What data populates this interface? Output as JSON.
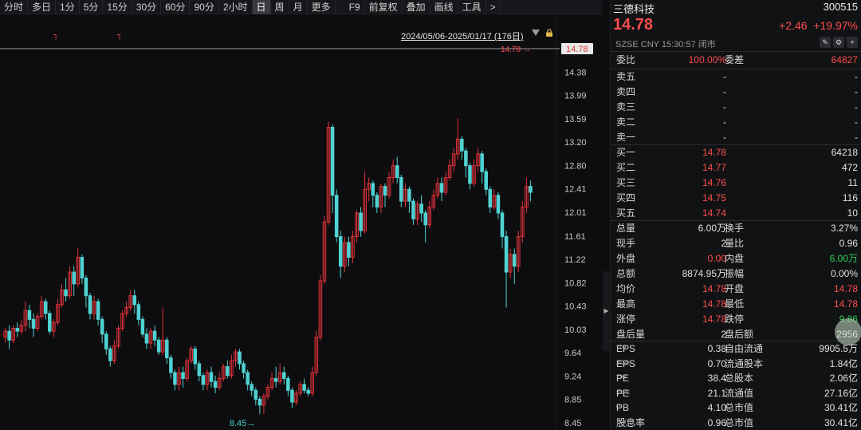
{
  "toolbar": {
    "periods": [
      "分时",
      "多日",
      "1分",
      "5分",
      "15分",
      "30分",
      "60分",
      "90分",
      "2小时",
      "日",
      "周",
      "月",
      "更多"
    ],
    "active_period": "日",
    "tools": [
      "F9",
      "前复权",
      "叠加",
      "画线",
      "工具",
      ">"
    ]
  },
  "chart": {
    "range_label": "2024/05/06-2025/01/17 (176日)",
    "price_levels": [
      "14.78",
      "14.38",
      "13.99",
      "13.59",
      "13.20",
      "12.80",
      "12.41",
      "12.01",
      "11.61",
      "11.22",
      "10.82",
      "10.43",
      "10.03",
      "9.64",
      "9.24",
      "8.85",
      "8.45"
    ],
    "current_price_tag": "14.78",
    "current_price_line_label": "14.78",
    "low_marker": "8.45",
    "ymin": 8.45,
    "ymax": 14.78,
    "up_color": "#e0333a",
    "down_color": "#4fd2d2",
    "candles": [
      [
        9.9,
        10.0,
        10.05,
        9.8
      ],
      [
        10.0,
        9.85,
        10.1,
        9.7
      ],
      [
        9.85,
        10.05,
        10.1,
        9.8
      ],
      [
        10.05,
        10.0,
        10.15,
        9.9
      ],
      [
        10.0,
        10.1,
        10.2,
        9.95
      ],
      [
        10.1,
        10.35,
        10.5,
        10.0
      ],
      [
        10.35,
        10.2,
        10.45,
        10.05
      ],
      [
        10.2,
        10.05,
        10.3,
        9.9
      ],
      [
        10.05,
        10.25,
        10.3,
        10.0
      ],
      [
        10.25,
        10.5,
        10.6,
        10.2
      ],
      [
        10.5,
        10.3,
        10.55,
        10.2
      ],
      [
        10.3,
        10.0,
        10.35,
        9.95
      ],
      [
        10.0,
        10.15,
        10.2,
        9.9
      ],
      [
        10.15,
        10.45,
        10.55,
        10.1
      ],
      [
        10.45,
        10.7,
        10.8,
        10.4
      ],
      [
        10.7,
        10.6,
        10.9,
        10.5
      ],
      [
        10.6,
        11.0,
        11.1,
        10.55
      ],
      [
        11.0,
        10.8,
        11.1,
        10.6
      ],
      [
        10.8,
        11.25,
        11.4,
        10.75
      ],
      [
        11.25,
        10.9,
        11.3,
        10.8
      ],
      [
        10.9,
        10.6,
        10.95,
        10.4
      ],
      [
        10.6,
        10.3,
        10.65,
        10.2
      ],
      [
        10.3,
        10.5,
        10.6,
        10.2
      ],
      [
        10.5,
        10.2,
        10.55,
        10.1
      ],
      [
        10.2,
        9.95,
        10.25,
        9.8
      ],
      [
        9.95,
        9.7,
        10.0,
        9.6
      ],
      [
        9.7,
        9.5,
        9.75,
        9.4
      ],
      [
        9.5,
        9.75,
        9.85,
        9.45
      ],
      [
        9.75,
        10.05,
        10.1,
        9.7
      ],
      [
        10.05,
        10.3,
        10.35,
        10.0
      ],
      [
        10.3,
        10.4,
        10.5,
        10.25
      ],
      [
        10.4,
        10.6,
        10.7,
        10.35
      ],
      [
        10.6,
        10.45,
        10.7,
        10.3
      ],
      [
        10.45,
        10.2,
        10.5,
        10.1
      ],
      [
        10.2,
        9.95,
        10.25,
        9.9
      ],
      [
        9.95,
        9.8,
        10.05,
        9.7
      ],
      [
        9.8,
        10.0,
        10.05,
        9.7
      ],
      [
        10.0,
        9.85,
        10.1,
        9.75
      ],
      [
        9.85,
        9.65,
        9.9,
        9.6
      ],
      [
        9.65,
        9.85,
        10.4,
        9.6
      ],
      [
        9.85,
        9.55,
        9.9,
        9.45
      ],
      [
        9.55,
        9.3,
        9.6,
        9.2
      ],
      [
        9.3,
        9.1,
        9.35,
        9.0
      ],
      [
        9.1,
        9.3,
        9.4,
        9.0
      ],
      [
        9.3,
        9.2,
        9.4,
        9.05
      ],
      [
        9.2,
        9.5,
        9.55,
        9.15
      ],
      [
        9.5,
        9.7,
        9.75,
        9.45
      ],
      [
        9.7,
        9.45,
        9.75,
        9.35
      ],
      [
        9.45,
        9.25,
        9.5,
        9.15
      ],
      [
        9.25,
        9.1,
        9.3,
        9.0
      ],
      [
        9.1,
        9.3,
        9.35,
        9.0
      ],
      [
        9.3,
        9.15,
        9.4,
        9.05
      ],
      [
        9.15,
        9.05,
        9.25,
        8.95
      ],
      [
        9.05,
        9.2,
        9.3,
        9.0
      ],
      [
        9.2,
        9.4,
        9.45,
        9.15
      ],
      [
        9.4,
        9.25,
        9.5,
        9.2
      ],
      [
        9.25,
        9.5,
        9.6,
        9.2
      ],
      [
        9.5,
        9.65,
        9.7,
        9.4
      ],
      [
        9.65,
        9.45,
        9.7,
        9.35
      ],
      [
        9.45,
        9.3,
        9.5,
        9.2
      ],
      [
        9.3,
        9.1,
        9.35,
        9.0
      ],
      [
        9.1,
        9.0,
        9.15,
        8.9
      ],
      [
        9.0,
        8.85,
        9.05,
        8.75
      ],
      [
        8.85,
        8.75,
        8.9,
        8.6
      ],
      [
        8.75,
        8.9,
        8.95,
        8.6
      ],
      [
        8.9,
        9.05,
        9.1,
        8.85
      ],
      [
        9.05,
        9.2,
        9.3,
        9.0
      ],
      [
        9.2,
        9.15,
        9.4,
        9.05
      ],
      [
        9.15,
        9.3,
        9.45,
        9.1
      ],
      [
        9.3,
        9.2,
        9.4,
        9.1
      ],
      [
        9.2,
        9.0,
        9.25,
        8.9
      ],
      [
        9.0,
        8.8,
        9.05,
        8.7
      ],
      [
        8.8,
        8.95,
        9.0,
        8.75
      ],
      [
        8.95,
        9.1,
        9.15,
        8.9
      ],
      [
        9.1,
        9.0,
        9.2,
        8.95
      ],
      [
        9.0,
        8.95,
        9.05,
        8.9
      ],
      [
        8.95,
        9.3,
        9.4,
        8.9
      ],
      [
        9.3,
        9.9,
        10.0,
        9.25
      ],
      [
        9.9,
        10.85,
        10.95,
        9.85
      ],
      [
        10.85,
        11.85,
        11.95,
        10.8
      ],
      [
        11.85,
        13.45,
        13.55,
        11.8
      ],
      [
        13.45,
        12.3,
        13.5,
        12.0
      ],
      [
        12.3,
        11.6,
        12.4,
        11.5
      ],
      [
        11.6,
        11.1,
        11.7,
        10.9
      ],
      [
        11.1,
        11.5,
        11.6,
        11.0
      ],
      [
        11.5,
        11.25,
        11.6,
        11.1
      ],
      [
        11.25,
        11.6,
        11.7,
        11.15
      ],
      [
        11.6,
        12.0,
        12.05,
        11.5
      ],
      [
        12.0,
        11.7,
        12.1,
        11.6
      ],
      [
        11.7,
        12.4,
        12.7,
        11.65
      ],
      [
        12.4,
        12.5,
        12.6,
        12.2
      ],
      [
        12.5,
        12.3,
        12.55,
        12.1
      ],
      [
        12.3,
        12.1,
        12.35,
        12.0
      ],
      [
        12.1,
        12.45,
        12.5,
        12.0
      ],
      [
        12.45,
        12.3,
        12.5,
        12.1
      ],
      [
        12.3,
        12.6,
        12.7,
        12.25
      ],
      [
        12.6,
        12.8,
        12.9,
        12.5
      ],
      [
        12.8,
        12.6,
        12.95,
        12.5
      ],
      [
        12.6,
        12.2,
        12.65,
        12.1
      ],
      [
        12.2,
        12.4,
        12.5,
        12.1
      ],
      [
        12.4,
        12.2,
        12.45,
        12.0
      ],
      [
        12.2,
        11.9,
        12.25,
        11.8
      ],
      [
        11.9,
        12.15,
        12.2,
        11.8
      ],
      [
        12.15,
        12.0,
        12.3,
        11.85
      ],
      [
        12.0,
        11.8,
        12.05,
        11.5
      ],
      [
        11.8,
        12.1,
        12.2,
        11.75
      ],
      [
        12.1,
        12.3,
        12.4,
        12.05
      ],
      [
        12.3,
        12.5,
        12.6,
        12.25
      ],
      [
        12.5,
        12.35,
        12.6,
        12.2
      ],
      [
        12.35,
        12.6,
        12.7,
        12.3
      ],
      [
        12.6,
        12.8,
        12.9,
        12.55
      ],
      [
        12.8,
        13.0,
        13.1,
        12.7
      ],
      [
        13.0,
        13.25,
        13.6,
        12.9
      ],
      [
        13.25,
        13.05,
        13.3,
        12.9
      ],
      [
        13.05,
        12.8,
        13.1,
        12.6
      ],
      [
        12.8,
        12.5,
        12.85,
        12.4
      ],
      [
        12.5,
        12.8,
        12.9,
        12.45
      ],
      [
        12.8,
        13.0,
        13.1,
        12.7
      ],
      [
        13.0,
        12.7,
        13.05,
        12.5
      ],
      [
        12.7,
        12.4,
        12.75,
        12.3
      ],
      [
        12.4,
        12.1,
        12.45,
        12.0
      ],
      [
        12.1,
        12.3,
        12.4,
        12.05
      ],
      [
        12.3,
        12.0,
        12.35,
        11.9
      ],
      [
        12.0,
        11.6,
        12.05,
        11.4
      ],
      [
        11.6,
        11.0,
        11.7,
        10.4
      ],
      [
        11.0,
        11.3,
        11.4,
        10.9
      ],
      [
        11.3,
        11.1,
        11.4,
        10.8
      ],
      [
        11.1,
        11.6,
        11.7,
        11.0
      ],
      [
        11.6,
        12.1,
        12.2,
        11.5
      ],
      [
        12.1,
        12.45,
        12.6,
        12.0
      ],
      [
        12.45,
        12.35,
        12.55,
        12.2
      ]
    ],
    "prelim_marks": [
      "┐",
      "┐"
    ]
  },
  "panel": {
    "name": "三德科技",
    "code": "300515",
    "price": "14.78",
    "change": "+2.46",
    "change_pct": "+19.97%",
    "meta": "SZSE  CNY  15:30:57  闭市",
    "header_icons": [
      "edit-icon",
      "settings-icon",
      "add-icon"
    ],
    "wb": {
      "label": "委比",
      "value": "100.00%",
      "label2": "委差",
      "value2": "64827"
    },
    "asks": [
      {
        "label": "卖五",
        "price": "-",
        "vol": "-"
      },
      {
        "label": "卖四",
        "price": "-",
        "vol": "-"
      },
      {
        "label": "卖三",
        "price": "-",
        "vol": "-"
      },
      {
        "label": "卖二",
        "price": "-",
        "vol": "-"
      },
      {
        "label": "卖一",
        "price": "-",
        "vol": "-"
      }
    ],
    "bids": [
      {
        "label": "买一",
        "price": "14.78",
        "vol": "64218"
      },
      {
        "label": "买二",
        "price": "14.77",
        "vol": "472"
      },
      {
        "label": "买三",
        "price": "14.76",
        "vol": "11"
      },
      {
        "label": "买四",
        "price": "14.75",
        "vol": "116"
      },
      {
        "label": "买五",
        "price": "14.74",
        "vol": "10"
      }
    ],
    "stats": [
      {
        "l1": "总量",
        "v1": "6.00万",
        "c1": "white",
        "l2": "换手",
        "v2": "3.27%",
        "c2": "white"
      },
      {
        "l1": "现手",
        "v1": "2",
        "c1": "white",
        "l2": "量比",
        "v2": "0.96",
        "c2": "white"
      },
      {
        "l1": "外盘",
        "v1": "0.00",
        "c1": "red",
        "l2": "内盘",
        "v2": "6.00万",
        "c2": "green"
      },
      {
        "l1": "总额",
        "v1": "8874.95万",
        "c1": "white",
        "l2": "振幅",
        "v2": "0.00%",
        "c2": "white"
      },
      {
        "l1": "均价",
        "v1": "14.78",
        "c1": "red",
        "l2": "开盘",
        "v2": "14.78",
        "c2": "red"
      },
      {
        "l1": "最高",
        "v1": "14.78",
        "c1": "red",
        "l2": "最低",
        "v2": "14.78",
        "c2": "red"
      },
      {
        "l1": "涨停",
        "v1": "14.78",
        "c1": "red",
        "l2": "跌停",
        "v2": "9.86",
        "c2": "green"
      },
      {
        "l1": "盘后量",
        "v1": "2",
        "c1": "white",
        "l2": "盘后额",
        "v2": "2956",
        "c2": "white"
      }
    ],
    "fundamentals": [
      {
        "l1": "EPS",
        "s1": "TTM",
        "v1": "0.38",
        "l2": "自由流通",
        "s2": "",
        "v2": "9905.5万"
      },
      {
        "l1": "EPS",
        "s1": "2024E",
        "v1": "0.70",
        "l2": "流通股本",
        "s2": "",
        "v2": "1.84亿"
      },
      {
        "l1": "PE",
        "s1": "TTM",
        "v1": "38.4",
        "l2": "总股本",
        "s2": "",
        "v2": "2.06亿"
      },
      {
        "l1": "PE",
        "s1": "2024E",
        "v1": "21.1",
        "l2": "流通值",
        "s2": "",
        "v2": "27.16亿"
      },
      {
        "l1": "PB",
        "s1": "LF",
        "v1": "4.10",
        "l2": "总市值",
        "s2": "1",
        "v2": "30.41亿"
      },
      {
        "l1": "股息率",
        "s1": "TTM",
        "v1": "0.96",
        "l2": "总市值",
        "s2": "2",
        "v2": "30.41亿"
      }
    ]
  }
}
